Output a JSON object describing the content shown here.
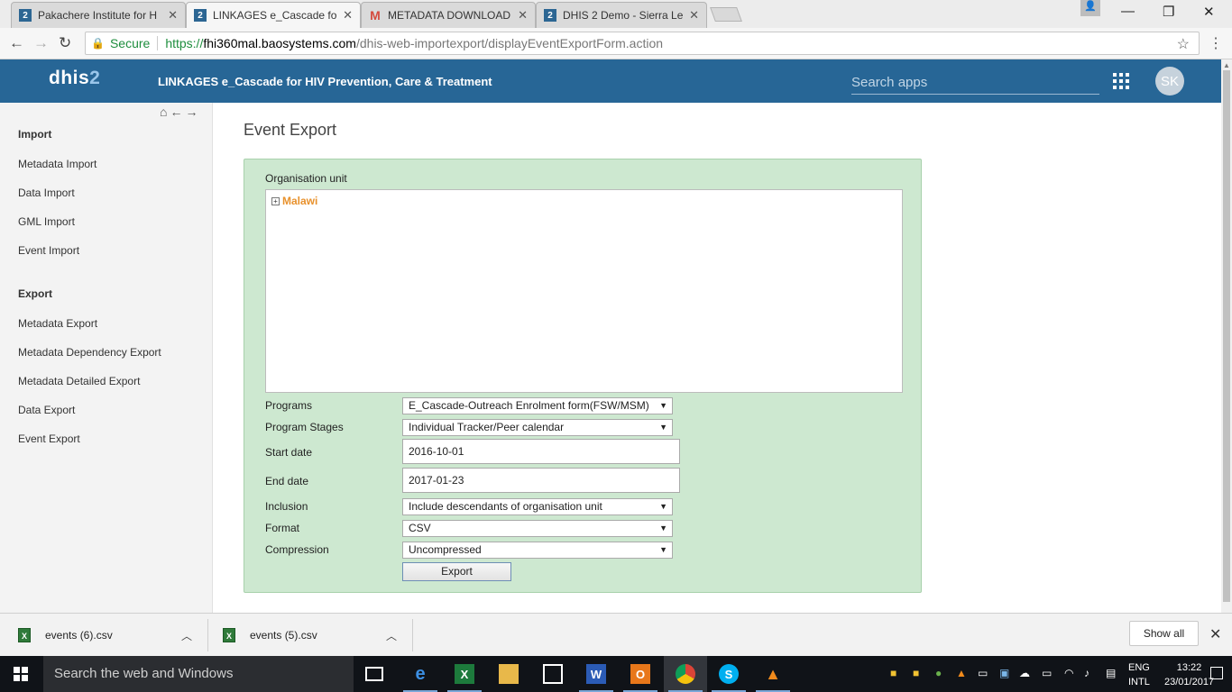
{
  "browser": {
    "tabs": [
      {
        "label": "Pakachere Institute for H",
        "icon": "2"
      },
      {
        "label": "LINKAGES e_Cascade for",
        "icon": "2",
        "active": true
      },
      {
        "label": "METADATA DOWNLOAD",
        "icon": "M"
      },
      {
        "label": "DHIS 2 Demo - Sierra Le",
        "icon": "2"
      }
    ],
    "secure_label": "Secure",
    "url_protocol": "https://",
    "url_host": "fhi360mal.baosystems.com",
    "url_path": "/dhis-web-importexport/displayEventExportForm.action"
  },
  "header": {
    "logo_text": "dhis",
    "logo_num": "2",
    "app_title": "LINKAGES e_Cascade for HIV Prevention, Care & Treatment",
    "search_placeholder": "Search apps",
    "avatar_initials": "SK",
    "color": "#276696"
  },
  "sidebar": {
    "import_title": "Import",
    "import_items": [
      "Metadata Import",
      "Data Import",
      "GML Import",
      "Event Import"
    ],
    "export_title": "Export",
    "export_items": [
      "Metadata Export",
      "Metadata Dependency Export",
      "Metadata Detailed Export",
      "Data Export",
      "Event Export"
    ]
  },
  "main": {
    "title": "Event Export",
    "org_unit_label": "Organisation unit",
    "org_root": "Malawi",
    "fields": {
      "programs_label": "Programs",
      "programs_value": "E_Cascade-Outreach Enrolment form(FSW/MSM)",
      "stages_label": "Program Stages",
      "stages_value": "Individual Tracker/Peer calendar",
      "start_label": "Start date",
      "start_value": "2016-10-01",
      "end_label": "End date",
      "end_value": "2017-01-23",
      "inclusion_label": "Inclusion",
      "inclusion_value": "Include descendants of organisation unit",
      "format_label": "Format",
      "format_value": "CSV",
      "compression_label": "Compression",
      "compression_value": "Uncompressed"
    },
    "export_button": "Export"
  },
  "downloads": {
    "items": [
      "events (6).csv",
      "events (5).csv"
    ],
    "show_all": "Show all"
  },
  "taskbar": {
    "search_placeholder": "Search the web and Windows",
    "lang_line1": "ENG",
    "lang_line2": "INTL",
    "time": "13:22",
    "date": "23/01/2017"
  }
}
